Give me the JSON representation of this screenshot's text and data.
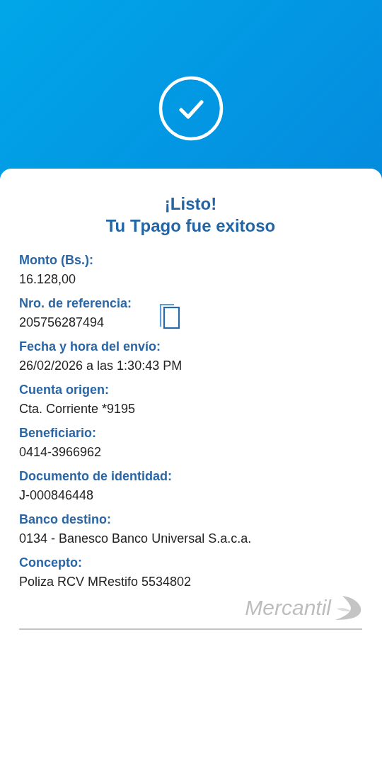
{
  "title": {
    "line_1": "¡Listo!",
    "line_2": "Tu Tpago fue exitoso"
  },
  "fields": [
    {
      "label": "Monto (Bs.):",
      "value": "16.128,00",
      "copyable": false
    },
    {
      "label": "Nro. de referencia:",
      "value": "205756287494",
      "copyable": true
    },
    {
      "label": "Fecha y hora del envío:",
      "value": "26/02/2026 a las 1:30:43 PM",
      "copyable": false
    },
    {
      "label": "Cuenta origen:",
      "value": "Cta. Corriente *9195",
      "copyable": false
    },
    {
      "label": "Beneficiario:",
      "value": "0414-3966962",
      "copyable": false
    },
    {
      "label": "Documento de identidad:",
      "value": "J-000846448",
      "copyable": false
    },
    {
      "label": "Banco destino:",
      "value": "0134 - Banesco Banco Universal S.a.c.a.",
      "copyable": false
    },
    {
      "label": "Concepto:",
      "value": "Poliza RCV MRestifo 5534802",
      "copyable": false
    }
  ],
  "logo": {
    "text": "Mercantil"
  }
}
